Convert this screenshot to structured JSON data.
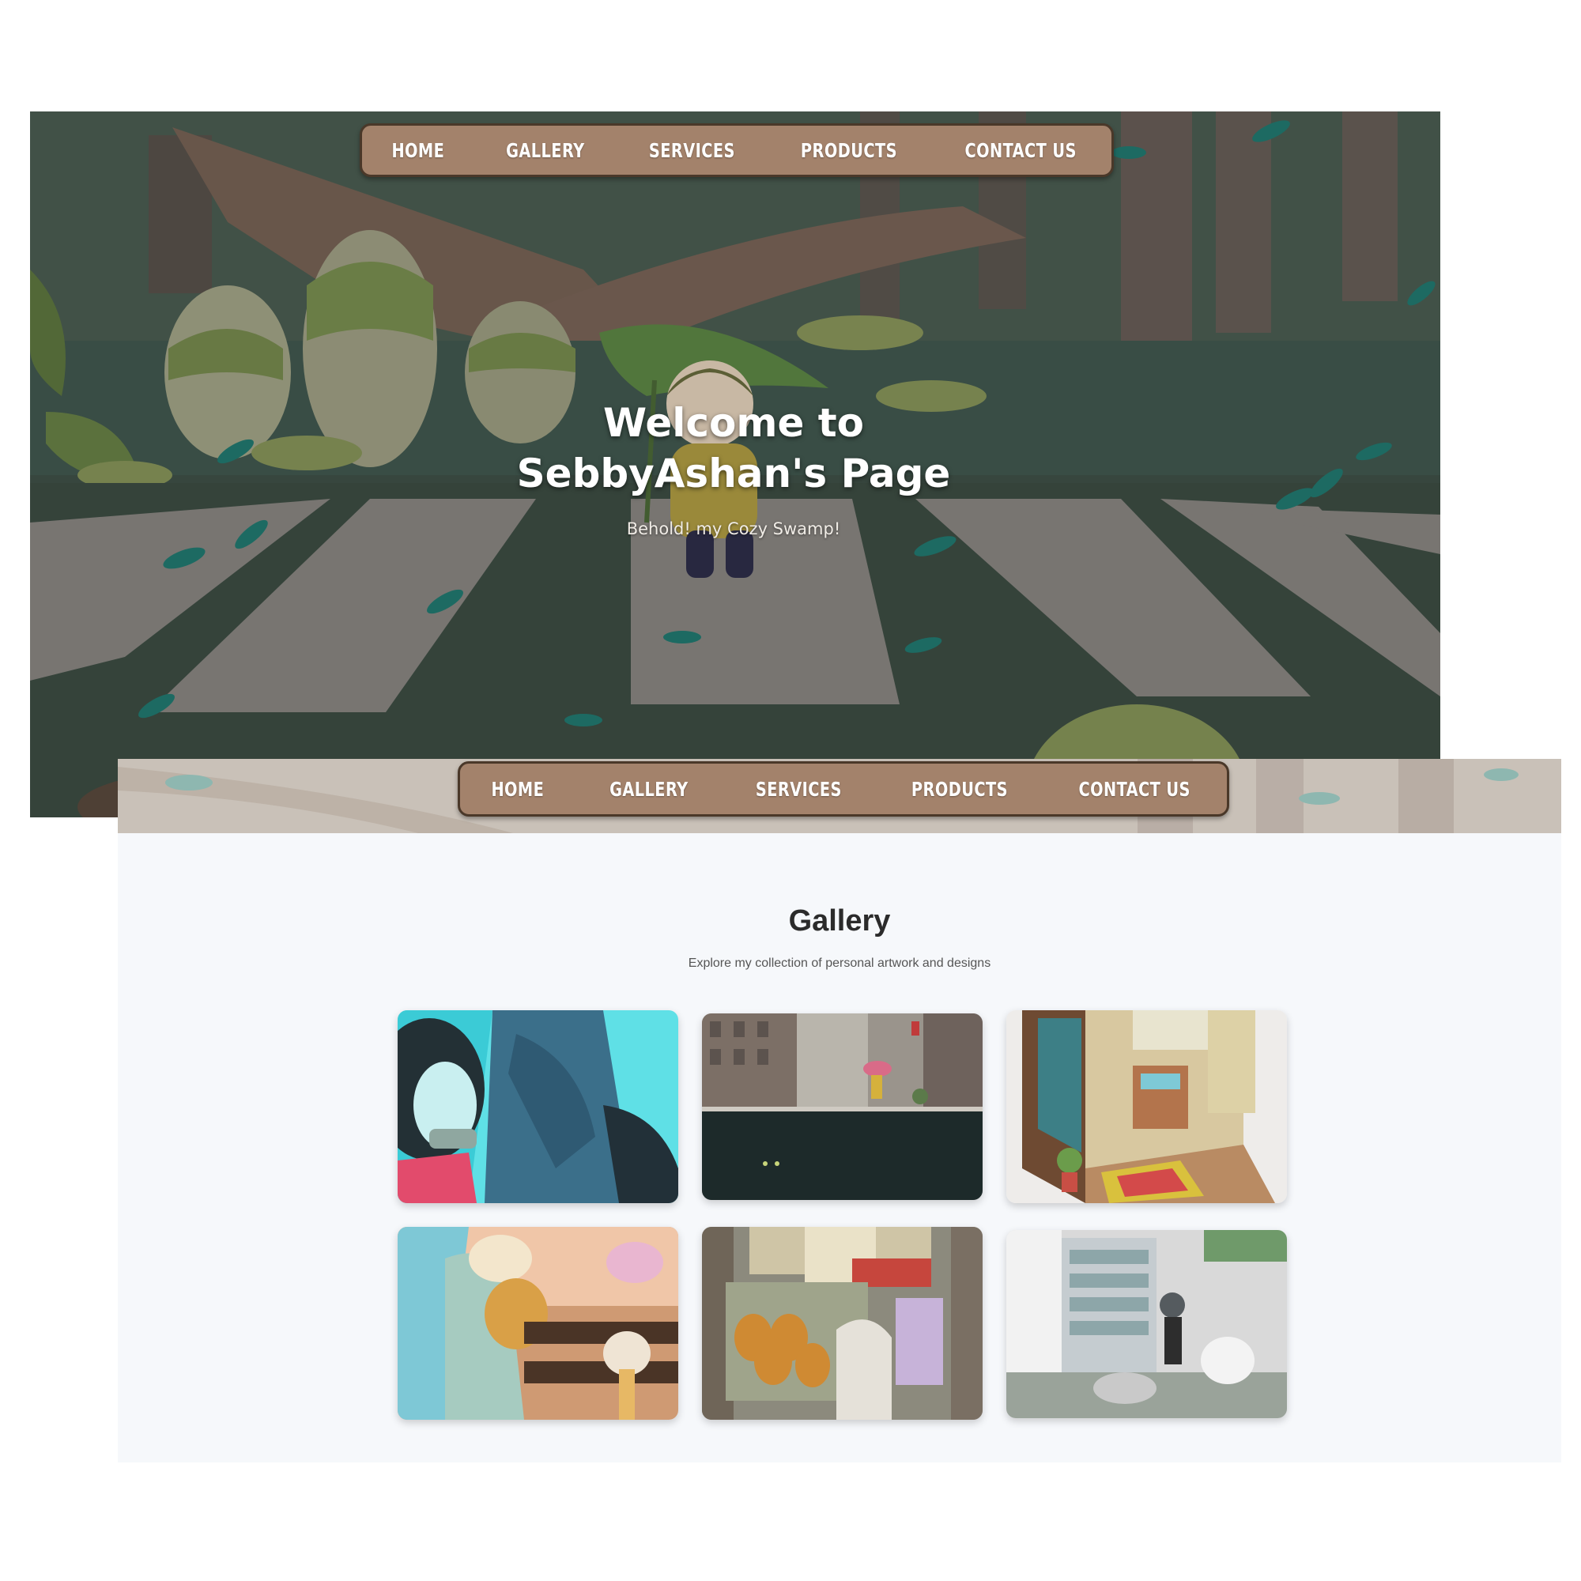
{
  "nav": {
    "items": [
      "HOME",
      "GALLERY",
      "SERVICES",
      "PRODUCTS",
      "CONTACT US"
    ]
  },
  "hero": {
    "title": "Welcome to SebbyAshan's Page",
    "subtitle": "Behold! my Cozy Swamp!"
  },
  "gallery": {
    "title": "Gallery",
    "subtitle": "Explore my collection of personal artwork and designs",
    "artworks": [
      {
        "name": "cyan-figure-artwork"
      },
      {
        "name": "rainy-city-street-artwork"
      },
      {
        "name": "cozy-room-artwork"
      },
      {
        "name": "mushroom-girl-artwork"
      },
      {
        "name": "grocery-ghost-artwork"
      },
      {
        "name": "vending-machine-artwork"
      }
    ]
  },
  "colors": {
    "nav_bg": "#a3826b",
    "nav_border": "#4a3829",
    "gallery_bg": "#f6f8fb",
    "swamp_green": "#3e4f44"
  }
}
